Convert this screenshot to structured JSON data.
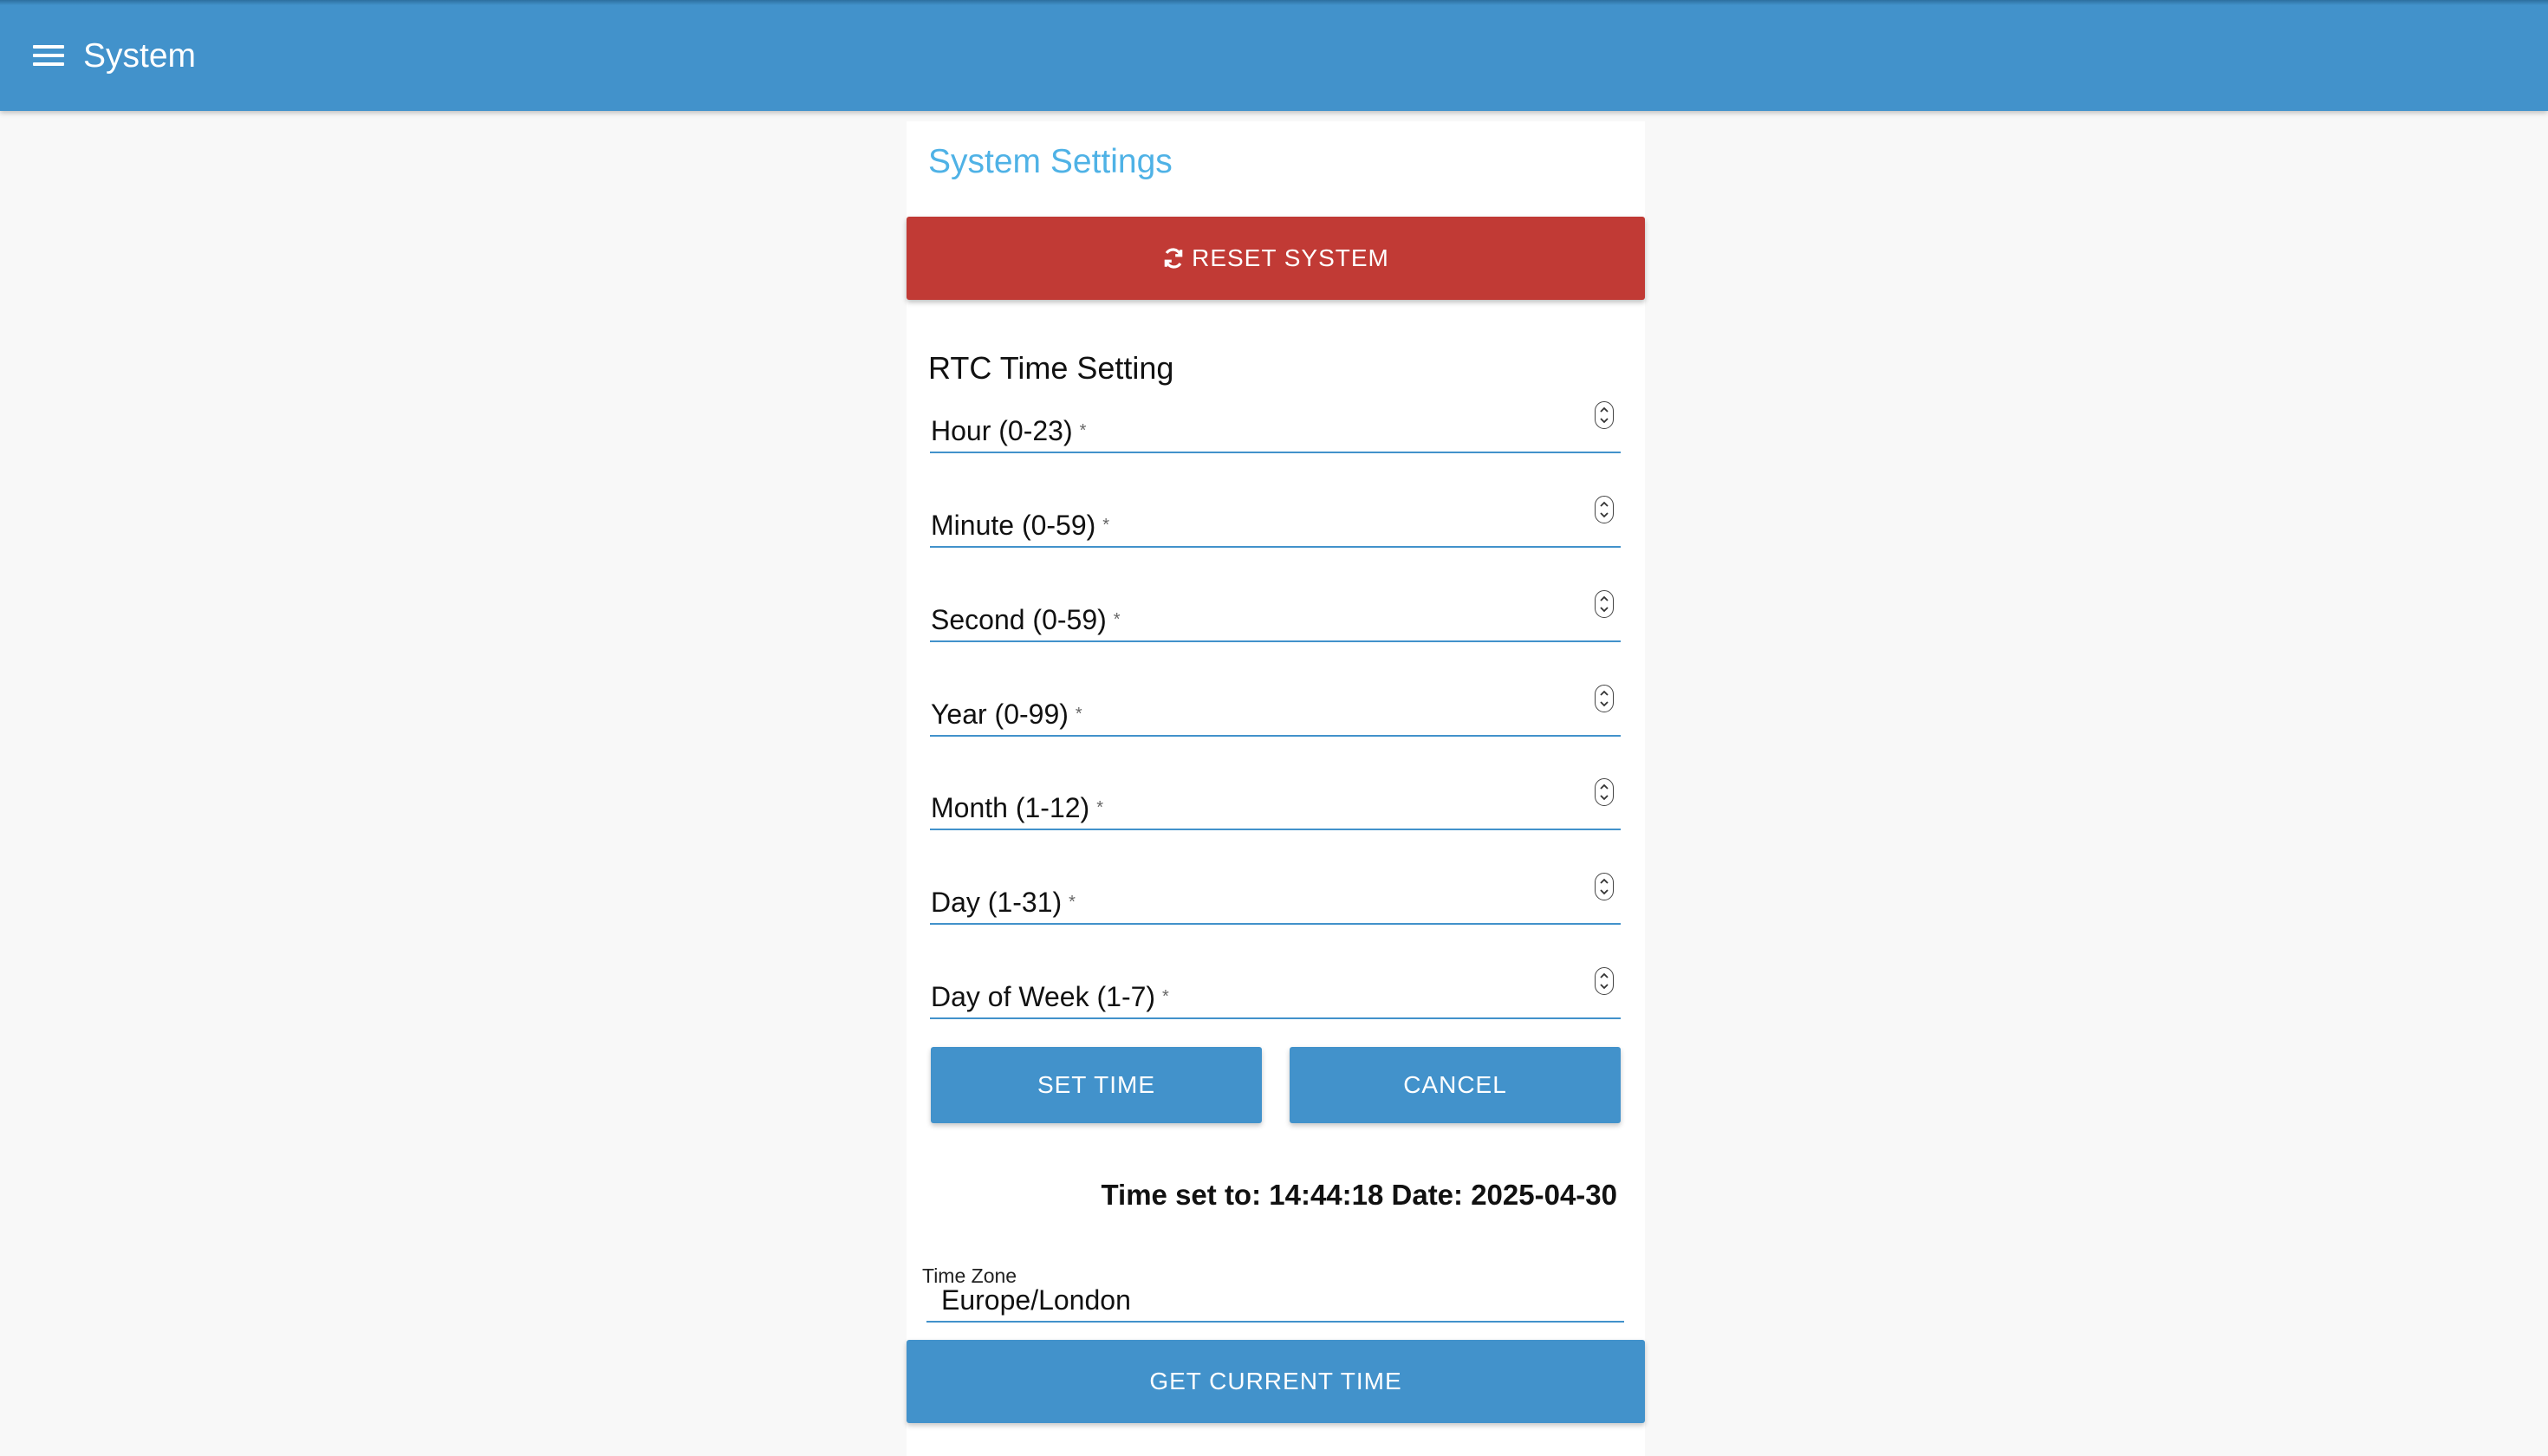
{
  "app": {
    "title": "System",
    "menu_icon": "menu-icon"
  },
  "settings": {
    "title": "System Settings",
    "reset_button": {
      "label": "RESET SYSTEM",
      "icon": "refresh-icon",
      "color": "#c13a35"
    }
  },
  "rtc": {
    "title": "RTC Time Setting",
    "fields": [
      {
        "label": "Hour (0-23)",
        "required": "*",
        "value": ""
      },
      {
        "label": "Minute (0-59)",
        "required": "*",
        "value": ""
      },
      {
        "label": "Second (0-59)",
        "required": "*",
        "value": ""
      },
      {
        "label": "Year (0-99)",
        "required": "*",
        "value": ""
      },
      {
        "label": "Month (1-12)",
        "required": "*",
        "value": ""
      },
      {
        "label": "Day (1-31)",
        "required": "*",
        "value": ""
      },
      {
        "label": "Day of Week (1-7)",
        "required": "*",
        "value": ""
      }
    ],
    "set_time_button": "SET TIME",
    "cancel_button": "CANCEL",
    "status": "Time set to: 14:44:18 Date: 2025-04-30"
  },
  "timezone": {
    "label": "Time Zone",
    "value": "Europe/London"
  },
  "get_time_button": "GET CURRENT TIME",
  "colors": {
    "primary": "#4292cb",
    "danger": "#c13a35",
    "heading": "#4fb2e6"
  }
}
